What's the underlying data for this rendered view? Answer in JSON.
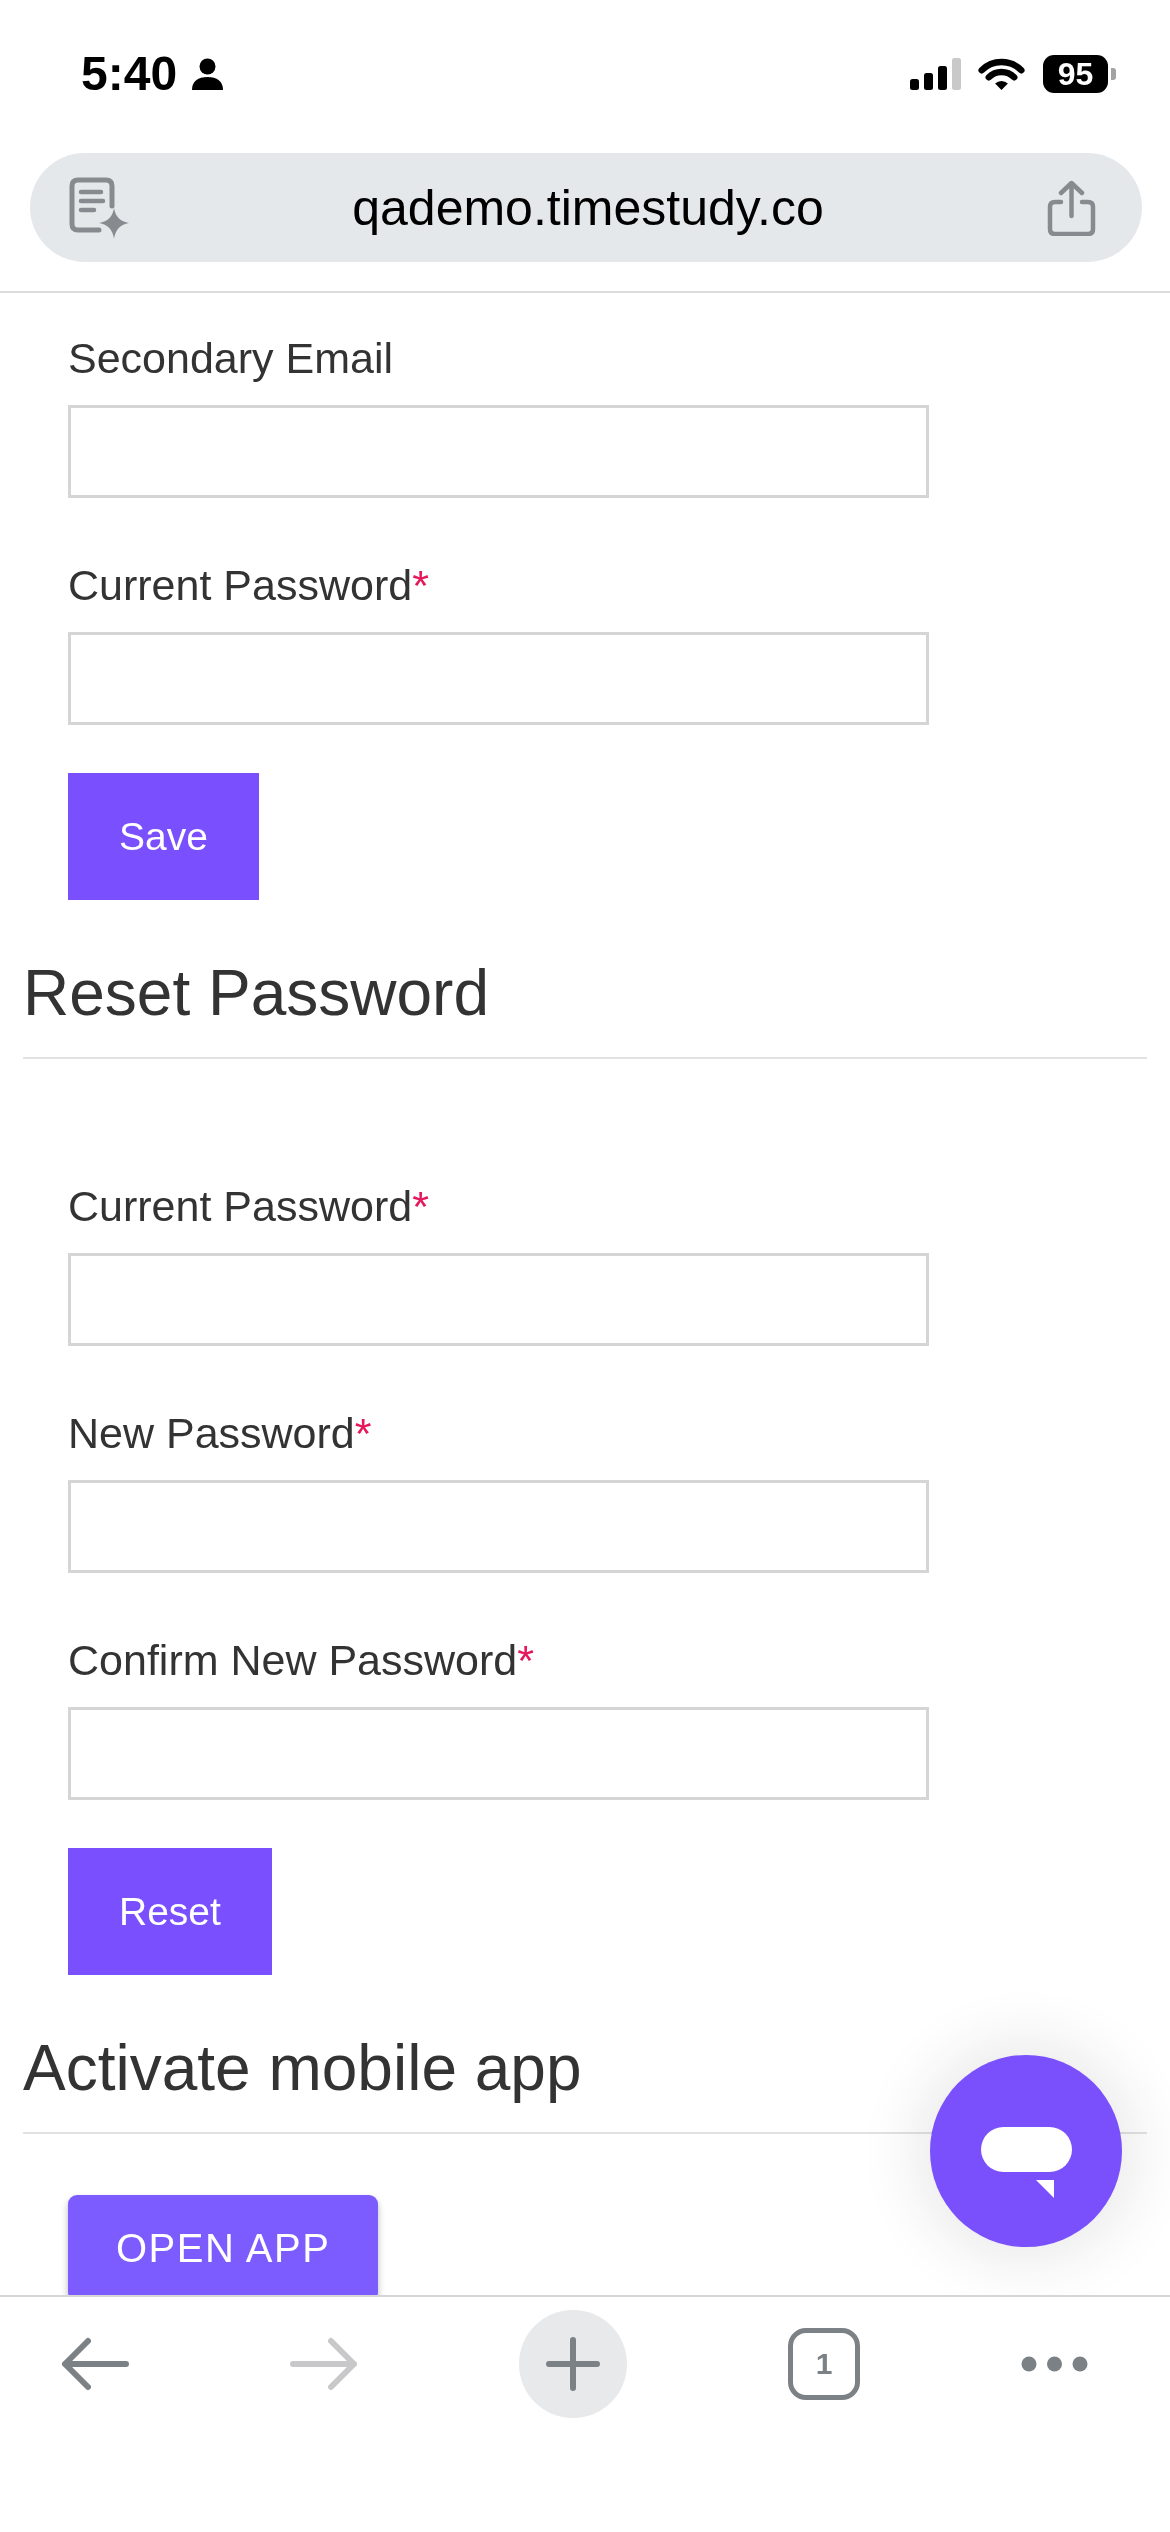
{
  "status_bar": {
    "time": "5:40",
    "battery": "95"
  },
  "address_bar": {
    "url": "qademo.timestudy.co"
  },
  "sections": [
    {
      "kind": "form",
      "fields": [
        {
          "label": "Secondary Email"
        },
        {
          "label": "Current Password",
          "required_mark": "*"
        }
      ],
      "button": "Save"
    },
    {
      "kind": "form",
      "heading": "Reset Password",
      "fields": [
        {
          "label": "Current Password",
          "required_mark": "*"
        },
        {
          "label": "New Password",
          "required_mark": "*"
        },
        {
          "label": "Confirm New Password",
          "required_mark": "*"
        }
      ],
      "button": "Reset"
    },
    {
      "kind": "action",
      "heading": "Activate mobile app",
      "button": "OPEN APP"
    }
  ],
  "toolbar": [
    {
      "kind": "back",
      "disabled": false
    },
    {
      "kind": "forward",
      "disabled": true
    },
    {
      "kind": "new_tab",
      "disabled": false
    },
    {
      "kind": "tabs",
      "count": "1",
      "disabled": false
    },
    {
      "kind": "more",
      "disabled": false
    }
  ]
}
